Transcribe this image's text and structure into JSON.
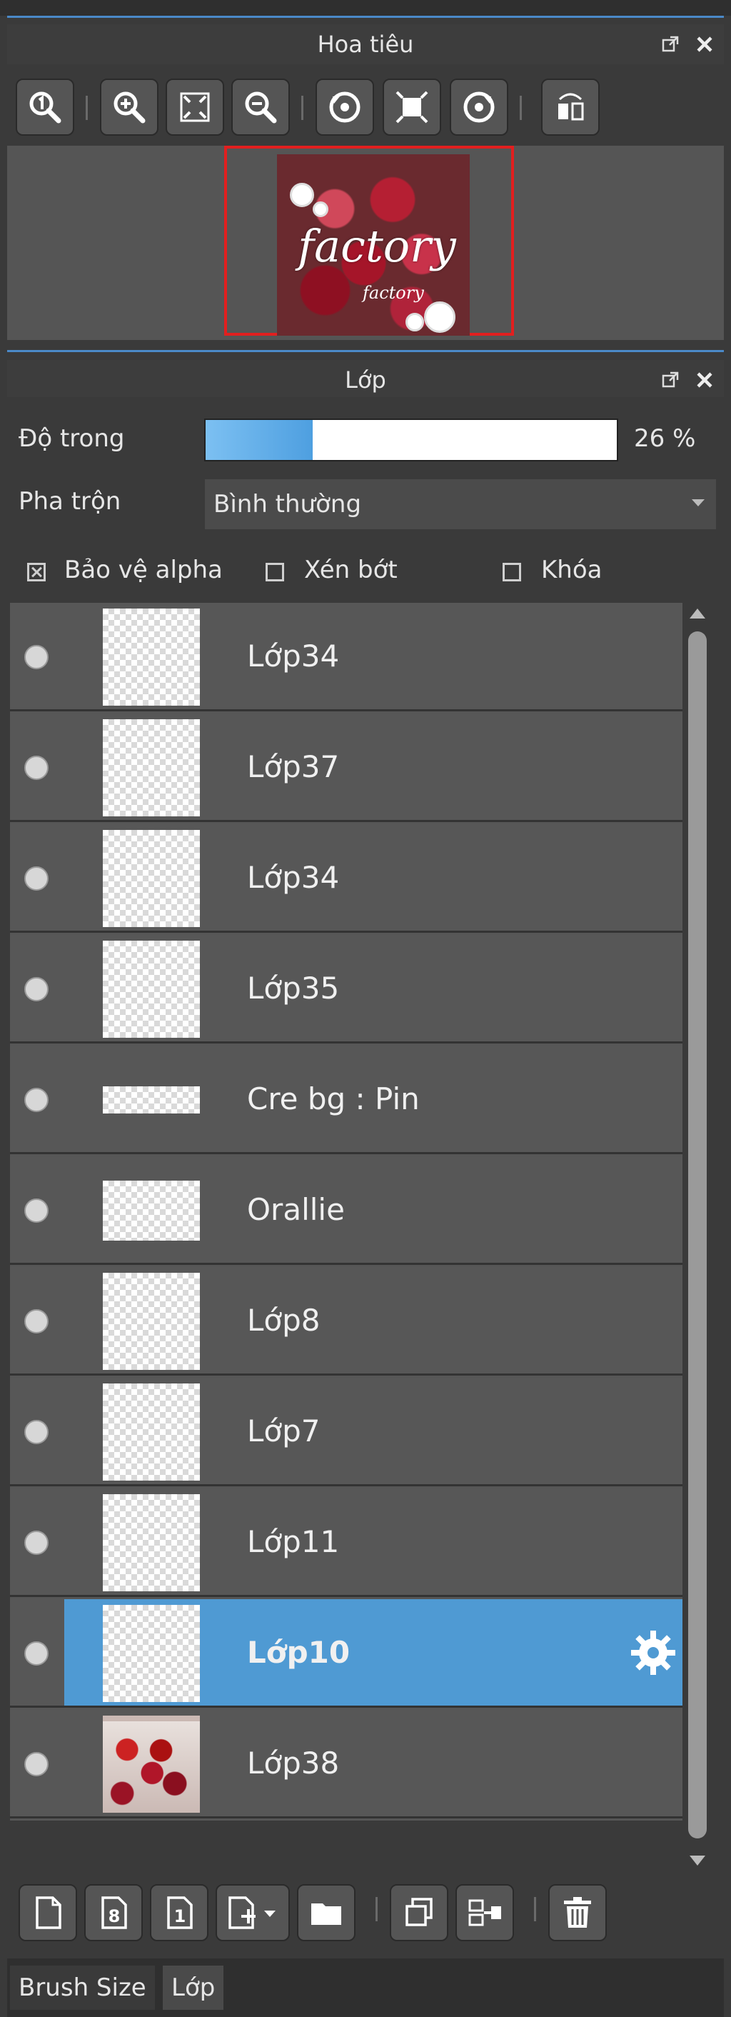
{
  "navigator": {
    "title": "Hoa tiêu",
    "toolbar": [
      {
        "icon": "zoom-actual-icon"
      },
      {
        "icon": "zoom-in-icon"
      },
      {
        "icon": "fit-screen-icon"
      },
      {
        "icon": "zoom-out-icon"
      },
      {
        "icon": "rotate-left-icon"
      },
      {
        "icon": "reset-view-icon"
      },
      {
        "icon": "rotate-right-icon"
      },
      {
        "icon": "flip-horizontal-icon"
      }
    ],
    "preview": {
      "text_large": "factory",
      "text_small": "factory"
    }
  },
  "layers_panel": {
    "title": "Lớp",
    "opacity_label": "Độ trong",
    "opacity_value": 0.26,
    "opacity_text": "26 %",
    "blend_label": "Pha trộn",
    "blend_value": "Bình thường",
    "checkboxes": [
      {
        "label": "Bảo vệ alpha",
        "checked": true
      },
      {
        "label": "Xén bớt",
        "checked": false
      },
      {
        "label": "Khóa",
        "checked": false
      }
    ],
    "layers": [
      {
        "name": "Lớp34",
        "selected": false
      },
      {
        "name": "Lớp37",
        "selected": false
      },
      {
        "name": "Lớp34",
        "selected": false
      },
      {
        "name": "Lớp35",
        "selected": false
      },
      {
        "name": "Cre bg : Pin",
        "selected": false
      },
      {
        "name": "Orallie",
        "selected": false
      },
      {
        "name": "Lớp8",
        "selected": false
      },
      {
        "name": "Lớp7",
        "selected": false
      },
      {
        "name": "Lớp11",
        "selected": false
      },
      {
        "name": "Lớp10",
        "selected": true
      },
      {
        "name": "Lớp38",
        "selected": false
      }
    ],
    "bottom_toolbar": [
      {
        "icon": "new-layer-icon"
      },
      {
        "icon": "new-8bit-layer-icon"
      },
      {
        "icon": "new-1bit-layer-icon"
      },
      {
        "icon": "add-layer-dropdown-icon"
      },
      {
        "icon": "folder-icon"
      },
      {
        "icon": "duplicate-layer-icon"
      },
      {
        "icon": "merge-down-icon"
      },
      {
        "icon": "delete-layer-icon"
      }
    ]
  },
  "tabs": [
    {
      "label": "Brush Size",
      "active": false
    },
    {
      "label": "Lớp",
      "active": true
    }
  ],
  "colors": {
    "accent": "#4a89c8",
    "selected_row": "#4f9ad3",
    "preview_frame": "#e21f1f"
  }
}
